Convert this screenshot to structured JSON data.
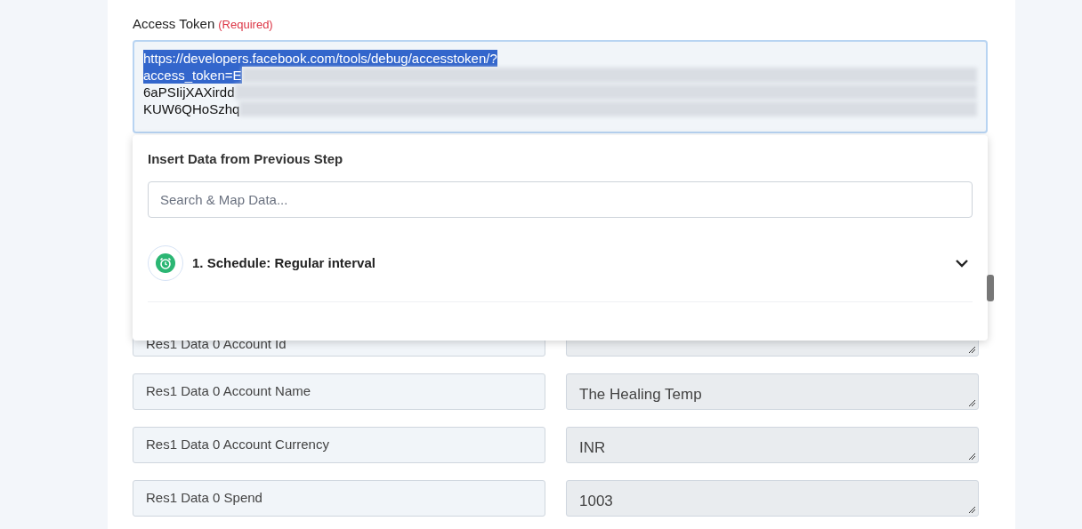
{
  "access_token": {
    "label": "Access Token",
    "required_note": "(Required)",
    "lines": [
      {
        "text": "https://developers.facebook.com/tools/debug/accesstoken/?",
        "selected": true,
        "blurred": false
      },
      {
        "text": "access_token=E",
        "selected": true,
        "blurred": true
      },
      {
        "text": "6aPSIijXAXirdd",
        "selected": false,
        "blurred": true
      },
      {
        "text": "KUW6QHoSzhq",
        "selected": false,
        "blurred": true
      }
    ]
  },
  "insert_panel": {
    "title": "Insert Data from Previous Step",
    "search": {
      "placeholder": "Search & Map Data..."
    },
    "steps": [
      {
        "label": "1. Schedule: Regular interval",
        "expanded": false
      }
    ]
  },
  "mappings": [
    {
      "name": "Res1 Data 0 Account Id"
    },
    {
      "name": "Res1 Data 0 Account Name",
      "value": "The Healing Temp"
    },
    {
      "name": "Res1 Data 0 Account Currency",
      "value": "INR"
    },
    {
      "name": "Res1 Data 0 Spend",
      "value": "1003"
    }
  ]
}
